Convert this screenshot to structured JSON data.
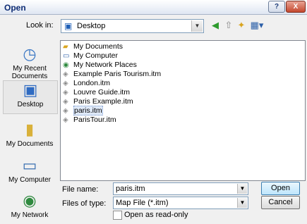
{
  "window": {
    "title": "Open",
    "help_label": "?",
    "close_label": "X"
  },
  "lookin": {
    "label": "Look in:",
    "value": "Desktop"
  },
  "places": [
    {
      "label": "My Recent Documents",
      "icon": "recent-documents-icon"
    },
    {
      "label": "Desktop",
      "icon": "desktop-icon"
    },
    {
      "label": "My Documents",
      "icon": "my-documents-icon"
    },
    {
      "label": "My Computer",
      "icon": "my-computer-icon"
    },
    {
      "label": "My Network",
      "icon": "my-network-icon"
    }
  ],
  "files": [
    {
      "name": "My Documents",
      "icon": "folder-icon"
    },
    {
      "name": "My Computer",
      "icon": "computer-icon"
    },
    {
      "name": "My Network Places",
      "icon": "network-icon"
    },
    {
      "name": "Example Paris Tourism.itm",
      "icon": "map-file-icon"
    },
    {
      "name": "London.itm",
      "icon": "map-file-icon"
    },
    {
      "name": "Louvre Guide.itm",
      "icon": "map-file-icon"
    },
    {
      "name": "Paris Example.itm",
      "icon": "map-file-icon"
    },
    {
      "name": "paris.itm",
      "icon": "map-file-icon",
      "selected": true
    },
    {
      "name": "ParisTour.itm",
      "icon": "map-file-icon"
    }
  ],
  "filename": {
    "label": "File name:",
    "value": "paris.itm"
  },
  "filetype": {
    "label": "Files of type:",
    "value": "Map File (*.itm)"
  },
  "readonly": {
    "label": "Open as read-only",
    "checked": false
  },
  "buttons": {
    "open": "Open",
    "cancel": "Cancel"
  }
}
